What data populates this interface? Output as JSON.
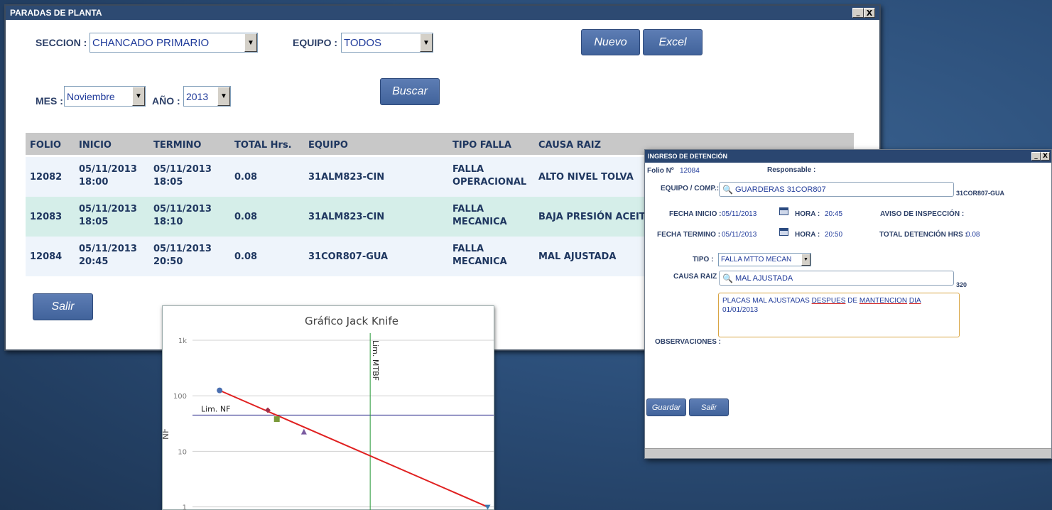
{
  "main_window": {
    "title": "PARADAS DE PLANTA",
    "min_btn": "_",
    "close_btn": "X"
  },
  "filters": {
    "seccion_label": "SECCION :",
    "seccion_value": "CHANCADO PRIMARIO",
    "equipo_label": "EQUIPO :",
    "equipo_value": "TODOS",
    "mes_label": "MES :",
    "mes_value": "Noviembre",
    "anio_label": "AÑO :",
    "anio_value": "2013"
  },
  "buttons": {
    "nuevo": "Nuevo",
    "excel": "Excel",
    "buscar": "Buscar",
    "salir": "Salir"
  },
  "table": {
    "headers": {
      "folio": "FOLIO",
      "inicio": "INICIO",
      "termino": "TERMINO",
      "total": "TOTAL Hrs.",
      "equipo": "EQUIPO",
      "tipo": "TIPO FALLA",
      "causa": "CAUSA RAIZ"
    },
    "rows": [
      {
        "folio": "12082",
        "inicio_fecha": "05/11/2013",
        "inicio_hora": "18:00",
        "termino_fecha": "05/11/2013",
        "termino_hora": "18:05",
        "total": "0.08",
        "equipo": "31ALM823-CIN",
        "tipo_1": "FALLA",
        "tipo_2": "OPERACIONAL",
        "causa": "ALTO NIVEL TOLVA"
      },
      {
        "folio": "12083",
        "inicio_fecha": "05/11/2013",
        "inicio_hora": "18:05",
        "termino_fecha": "05/11/2013",
        "termino_hora": "18:10",
        "total": "0.08",
        "equipo": "31ALM823-CIN",
        "tipo_1": "FALLA",
        "tipo_2": "MECANICA",
        "causa": "BAJA PRESIÓN ACEIT"
      },
      {
        "folio": "12084",
        "inicio_fecha": "05/11/2013",
        "inicio_hora": "20:45",
        "termino_fecha": "05/11/2013",
        "termino_hora": "20:50",
        "total": "0.08",
        "equipo": "31COR807-GUA",
        "tipo_1": "FALLA",
        "tipo_2": "MECANICA",
        "causa": "MAL AJUSTADA"
      }
    ],
    "row_colors": [
      "#eef4fb",
      "#d5eee9",
      "#eef4fb"
    ],
    "header_color": "#c8c8c8"
  },
  "dialog": {
    "title": "INGRESO DE DETENCIÓN",
    "close_btn": "X",
    "min_btn": "_",
    "folio_label": "Folio Nº",
    "folio_value": "12084",
    "responsable_label": "Responsable :",
    "equipo_label": "EQUIPO / COMP.:",
    "equipo_value": "GUARDERAS  31COR807",
    "equipo_code": "31COR807-GUA",
    "fecha_inicio_label": "FECHA INICIO :",
    "fecha_inicio_value": "05/11/2013",
    "hora_label": "HORA :",
    "hora_inicio_value": "20:45",
    "aviso_label": "AVISO DE INSPECCIÓN :",
    "fecha_termino_label": "FECHA TERMINO :",
    "fecha_termino_value": "05/11/2013",
    "hora_termino_value": "20:50",
    "total_label": "TOTAL DETENCIÓN HRS :",
    "total_value": "0.08",
    "tipo_label": "TIPO :",
    "tipo_value": "FALLA MTTO MECAN",
    "causa_label": "CAUSA RAIZ :",
    "causa_value": "MAL AJUSTADA",
    "causa_code": "320",
    "observaciones_label": "OBSERVACIONES :",
    "obs_line1_a": "PLACAS MAL AJUSTADAS ",
    "obs_line1_b": "DESPUES",
    "obs_line1_c": " DE ",
    "obs_line1_d": "MANTENCION",
    "obs_line1_e": " ",
    "obs_line1_f": "DIA",
    "obs_line2": "01/01/2013",
    "guardar_btn": "Guardar",
    "salir_btn": "Salir"
  },
  "chart_data": {
    "type": "scatter",
    "title": "Gráfico Jack Knife",
    "ylabel": "NF",
    "xlabel": "",
    "y_scale": "log",
    "ylim": [
      0.6,
      1000
    ],
    "xlim": [
      0,
      10
    ],
    "y_ticks": [
      "1k",
      "100",
      "10",
      "1"
    ],
    "y_tick_values": [
      1000,
      100,
      10,
      1
    ],
    "lines": [
      {
        "name": "Lim. NF",
        "kind": "horizontal",
        "y": 45,
        "color": "#2c2c8c"
      },
      {
        "name": "Lim. MTBF",
        "kind": "vertical",
        "x": 5.9,
        "color": "#2a9a3a"
      }
    ],
    "trend": {
      "x": [
        0.9,
        9.8
      ],
      "y": [
        125,
        1
      ],
      "color": "#e02020"
    },
    "points": [
      {
        "x": 0.9,
        "y": 125,
        "shape": "circle",
        "color": "#4a6fb0"
      },
      {
        "x": 2.5,
        "y": 55,
        "shape": "diamond",
        "color": "#a0304a"
      },
      {
        "x": 2.8,
        "y": 38,
        "shape": "square",
        "color": "#7a9a3a"
      },
      {
        "x": 3.7,
        "y": 22,
        "shape": "triangle",
        "color": "#7a5aa0"
      },
      {
        "x": 9.8,
        "y": 1,
        "shape": "triangle-down",
        "color": "#3a7ab0"
      }
    ]
  }
}
